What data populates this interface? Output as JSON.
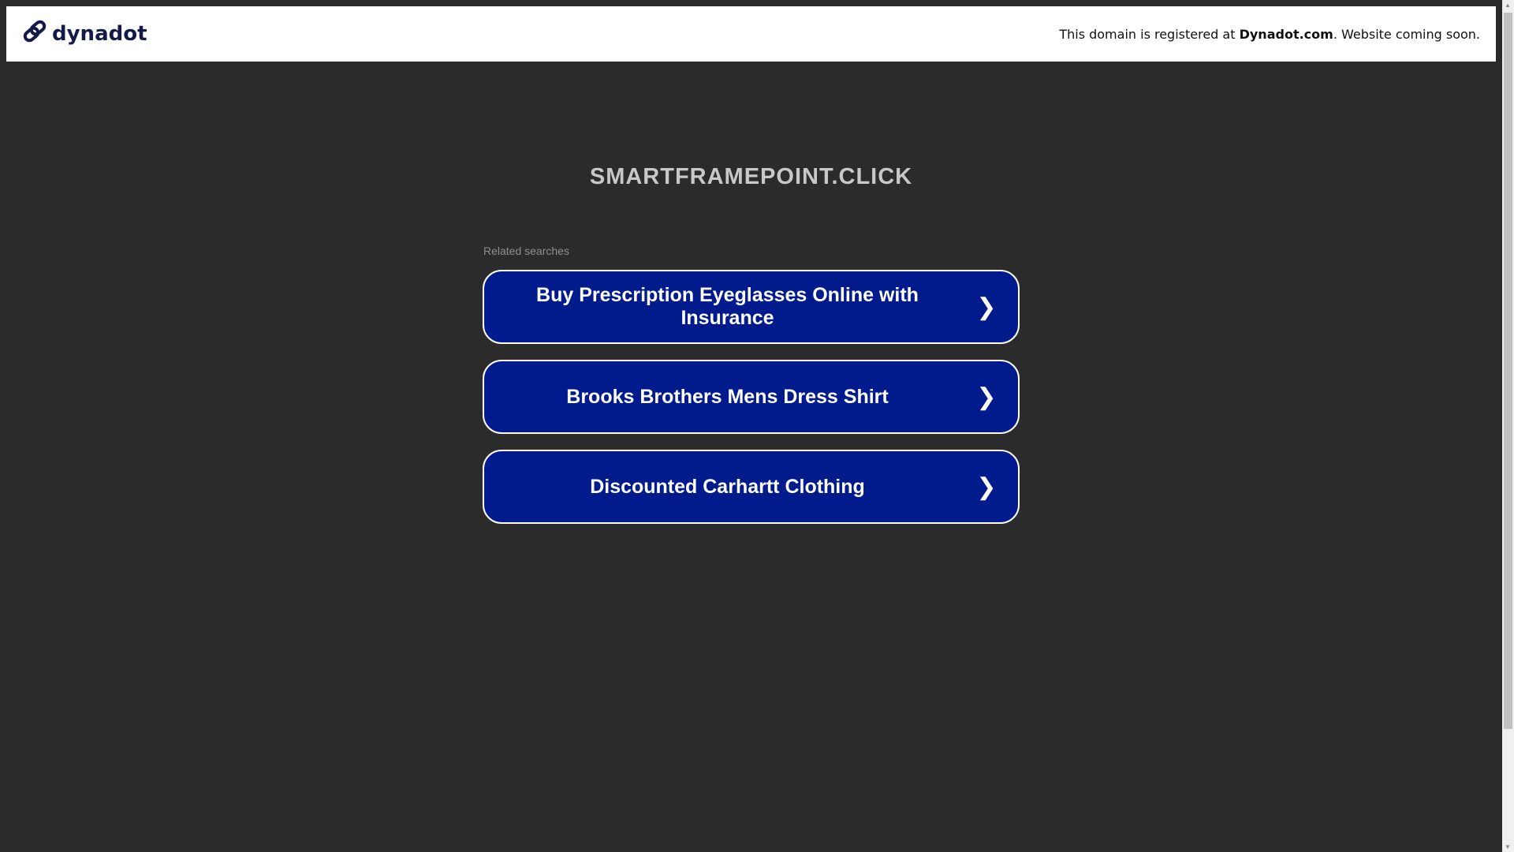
{
  "header": {
    "logo_text": "dynadot",
    "notice_prefix": "This domain is registered at ",
    "notice_brand": "Dynadot.com",
    "notice_suffix": ". Website coming soon."
  },
  "main": {
    "domain_title": "SMARTFRAMEPOINT.CLICK",
    "related_label": "Related searches",
    "links": [
      {
        "label": "Buy Prescription Eyeglasses Online with Insurance"
      },
      {
        "label": "Brooks Brothers Mens Dress Shirt"
      },
      {
        "label": "Discounted Carhartt Clothing"
      }
    ]
  },
  "colors": {
    "background": "#2b2b2b",
    "button": "#011a8c",
    "logo": "#131a4a"
  }
}
